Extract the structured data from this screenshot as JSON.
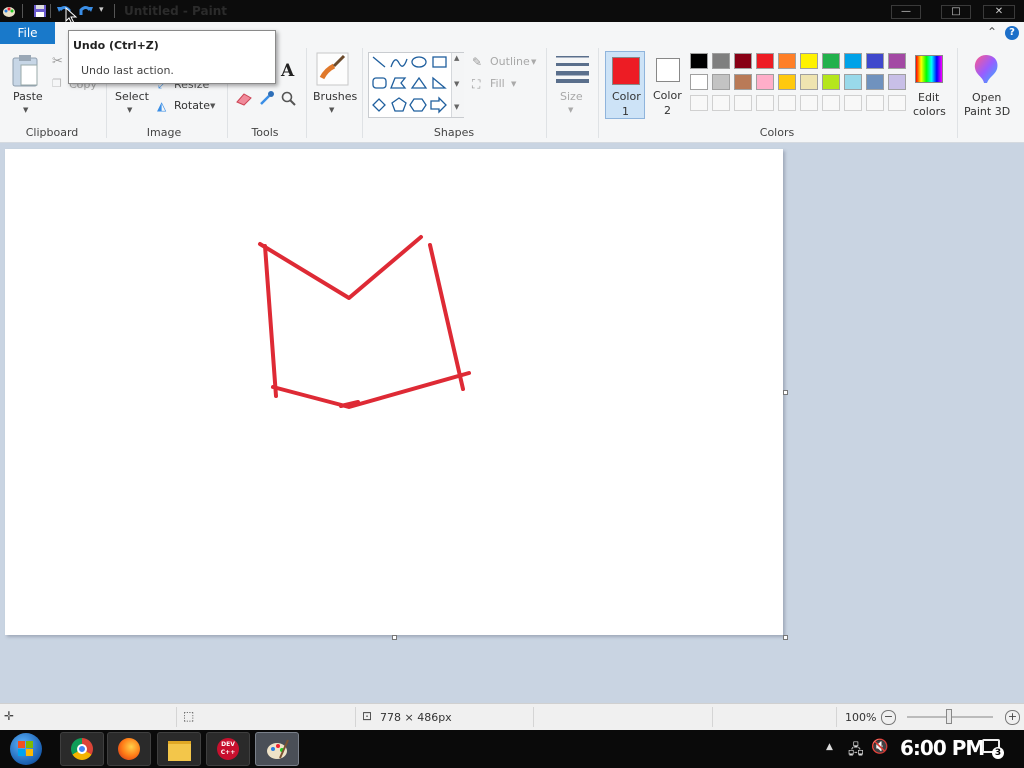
{
  "titlebar": {
    "title": "Untitled - Paint",
    "minimize": "—",
    "maximize": "□",
    "close": "✕"
  },
  "tabs": {
    "file": "File"
  },
  "tooltip": {
    "title": "Undo (Ctrl+Z)",
    "description": "Undo last action."
  },
  "ribbon": {
    "clipboard": {
      "paste": "Paste",
      "copy": "Copy",
      "label": "Clipboard"
    },
    "image": {
      "select": "Select",
      "resize": "Resize",
      "rotate": "Rotate",
      "label": "Image"
    },
    "tools": {
      "label": "Tools"
    },
    "brushes": {
      "label": "Brushes"
    },
    "shapes": {
      "outline": "Outline",
      "fill": "Fill",
      "label": "Shapes"
    },
    "size": {
      "label": "Size"
    },
    "colors": {
      "color1_line1": "Color",
      "color1_line2": "1",
      "color2_line1": "Color",
      "color2_line2": "2",
      "edit_line1": "Edit",
      "edit_line2": "colors",
      "label": "Colors",
      "color1_value": "#ed1c24",
      "color2_value": "#ffffff",
      "palette_row1": [
        "#000000",
        "#7f7f7f",
        "#880015",
        "#ed1c24",
        "#ff7f27",
        "#fff200",
        "#22b14c",
        "#00a2e8",
        "#3f48cc",
        "#a349a4"
      ],
      "palette_row2": [
        "#ffffff",
        "#c3c3c3",
        "#b97a57",
        "#ffaec9",
        "#ffc90e",
        "#efe4b0",
        "#b5e61d",
        "#99d9ea",
        "#7092be",
        "#c8bfe7"
      ]
    },
    "paint3d": {
      "line1": "Open",
      "line2": "Paint 3D"
    }
  },
  "canvas": {
    "stroke_color": "#de2a35"
  },
  "statusbar": {
    "dimensions": "778 × 486px",
    "zoom": "100%"
  },
  "taskbar": {
    "clock": "6:00 PM",
    "notifications": "3",
    "devcpp": "DEV C++"
  }
}
